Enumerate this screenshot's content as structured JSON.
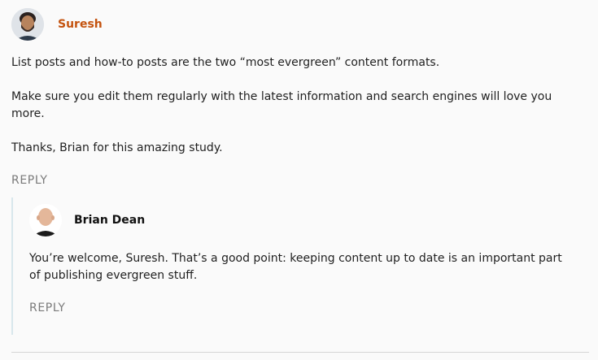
{
  "comments": [
    {
      "author": "Suresh",
      "author_color": "#c4530f",
      "paragraphs": [
        "List posts and how-to posts are the two “most evergreen” content formats.",
        "Make sure you edit them regularly with the latest information and search engines will love you more.",
        "Thanks, Brian for this amazing study."
      ],
      "reply_label": "REPLY"
    }
  ],
  "replies": [
    {
      "author": "Brian Dean",
      "paragraphs": [
        "You’re welcome, Suresh. That’s a good point: keeping content up to date is an important part of publishing evergreen stuff."
      ],
      "reply_label": "REPLY"
    }
  ],
  "icons": {
    "avatar_suresh": "person-avatar",
    "avatar_brian": "person-avatar"
  },
  "colors": {
    "reply_border": "#d8e7ec",
    "reply_link": "#7a7a7a",
    "background": "#fafafa"
  }
}
